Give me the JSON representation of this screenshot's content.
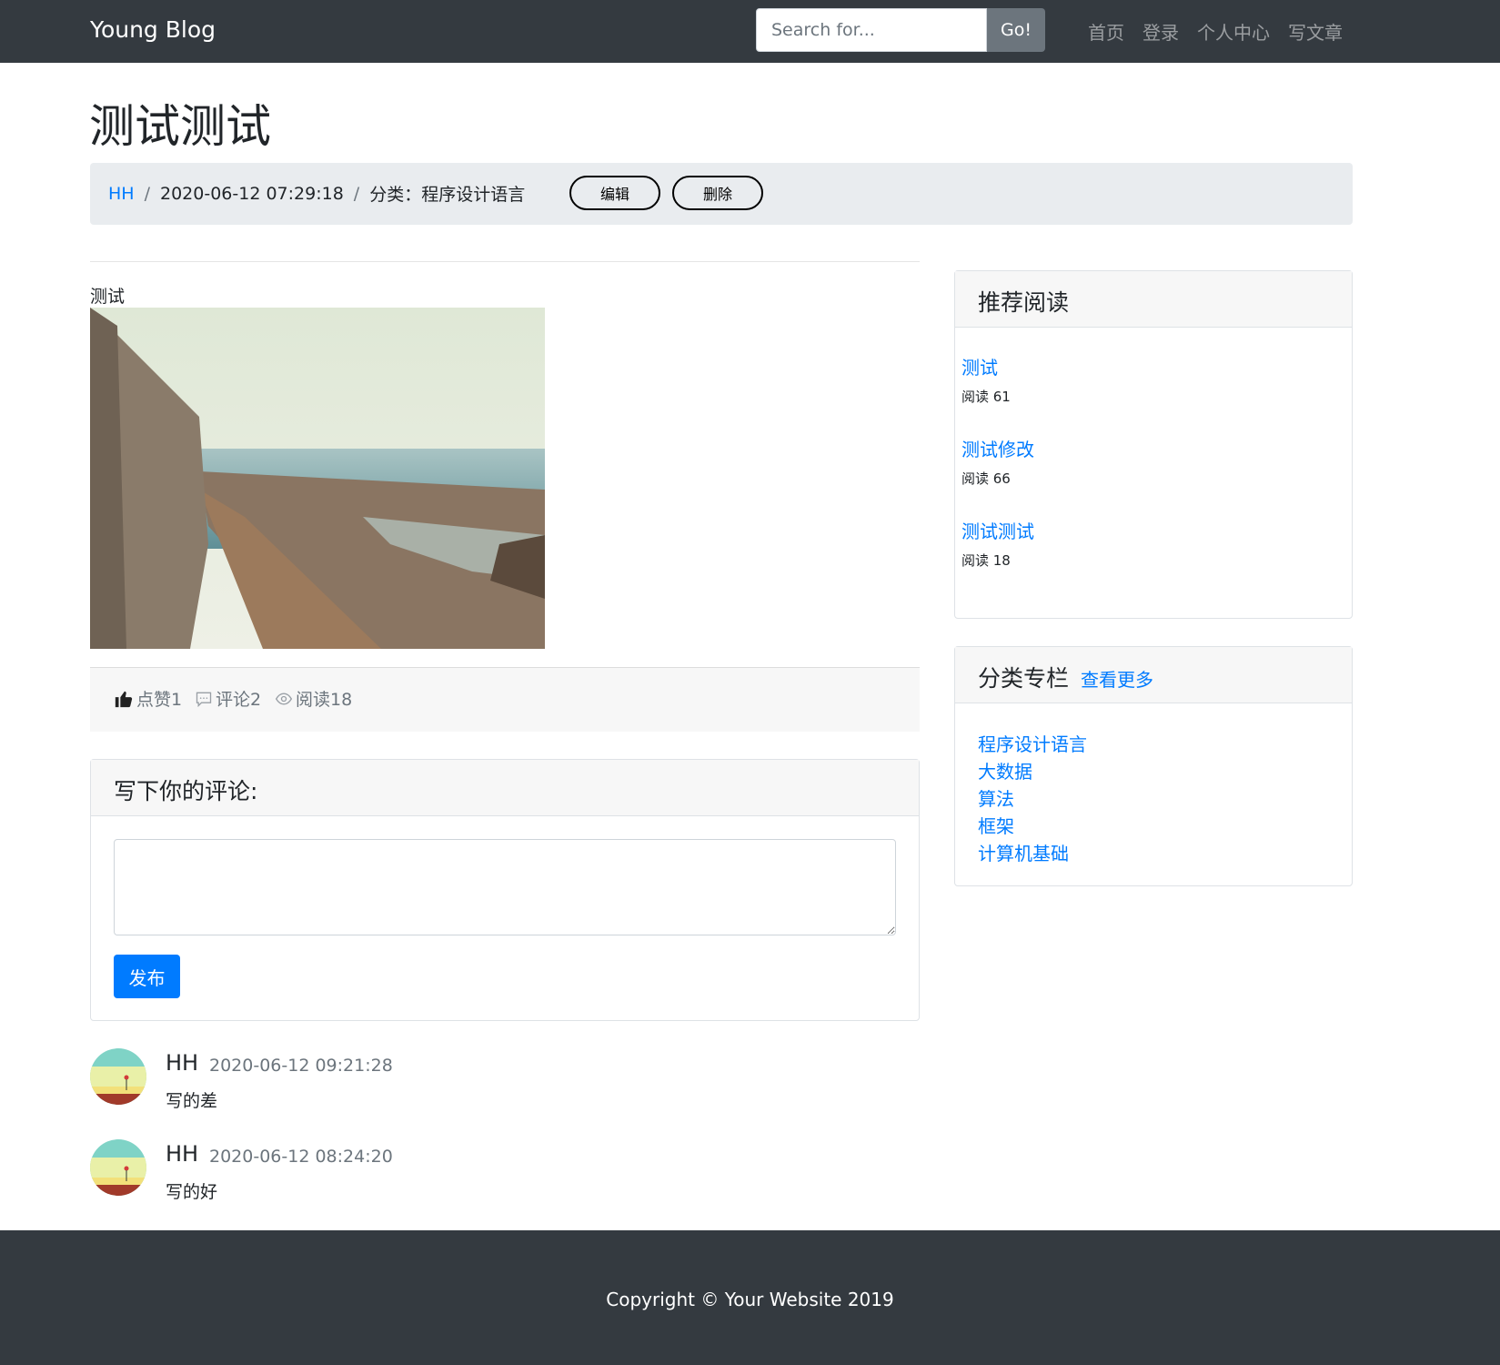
{
  "navbar": {
    "brand": "Young Blog",
    "search_placeholder": "Search for...",
    "search_button": "Go!",
    "links": [
      "首页",
      "登录",
      "个人中心",
      "写文章"
    ]
  },
  "post": {
    "title": "测试测试",
    "author": "HH",
    "datetime": "2020-06-12 07:29:18",
    "category": "分类：程序设计语言",
    "edit_label": "编辑",
    "delete_label": "删除",
    "body_text": "测试",
    "stats": {
      "likes": "点赞1",
      "comments": "评论2",
      "reads": "阅读18"
    }
  },
  "comment_form": {
    "title": "写下你的评论:",
    "textarea_value": "",
    "submit_label": "发布"
  },
  "comments": [
    {
      "author": "HH",
      "time": "2020-06-12 09:21:28",
      "text": "写的差"
    },
    {
      "author": "HH",
      "time": "2020-06-12 08:24:20",
      "text": "写的好"
    }
  ],
  "sidebar": {
    "recommend_title": "推荐阅读",
    "recommend": [
      {
        "title": "测试",
        "meta": "阅读  61"
      },
      {
        "title": "测试修改",
        "meta": "阅读  66"
      },
      {
        "title": "测试测试",
        "meta": "阅读  18"
      }
    ],
    "category_title": "分类专栏",
    "category_more": "查看更多",
    "categories": [
      "程序设计语言",
      "大数据",
      "算法",
      "框架",
      "计算机基础"
    ]
  },
  "footer": {
    "copyright": "Copyright © Your Website 2019"
  },
  "colors": {
    "navbar": "#343a40",
    "link": "#007bff",
    "primary_button": "#007bff",
    "muted": "#6c757d"
  }
}
